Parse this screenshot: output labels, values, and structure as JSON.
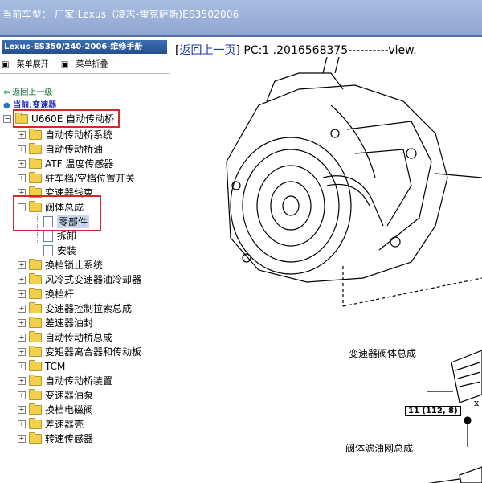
{
  "header": {
    "title": "当前车型：  厂家:Lexus（凌志-雷克萨斯)ES3502006"
  },
  "sidebar": {
    "manual_title": "Lexus-ES350/240-2006-维修手册",
    "expand_label": "菜单展开",
    "collapse_label": "菜单折叠",
    "back_label": "返回上一级",
    "current_label": "当前:变速器",
    "root": "U660E 自动传动桥",
    "items": [
      "自动传动桥系统",
      "自动传动桥油",
      "ATF 温度传感器",
      "驻车档/空档位置开关",
      "变速器线束",
      "阀体总成",
      "零部件",
      "拆卸",
      "安装",
      "换档锁止系统",
      "风冷式变速器油冷却器",
      "换档杆",
      "变速器控制拉索总成",
      "差速器油封",
      "自动传动桥总成",
      "变矩器离合器和传动板",
      "TCM",
      "自动传动桥装置",
      "变速器油泵",
      "换档电磁阀",
      "差速器壳",
      "转速传感器"
    ]
  },
  "content": {
    "back_link": "返回上一页",
    "path_text": " PC:1 .2016568375----------view.",
    "label_valve_body": "变速器阀体总成",
    "label_filter": "阀体滤油网总成",
    "torque_spec": "11 (112, 8)",
    "torque_mark": "x"
  }
}
